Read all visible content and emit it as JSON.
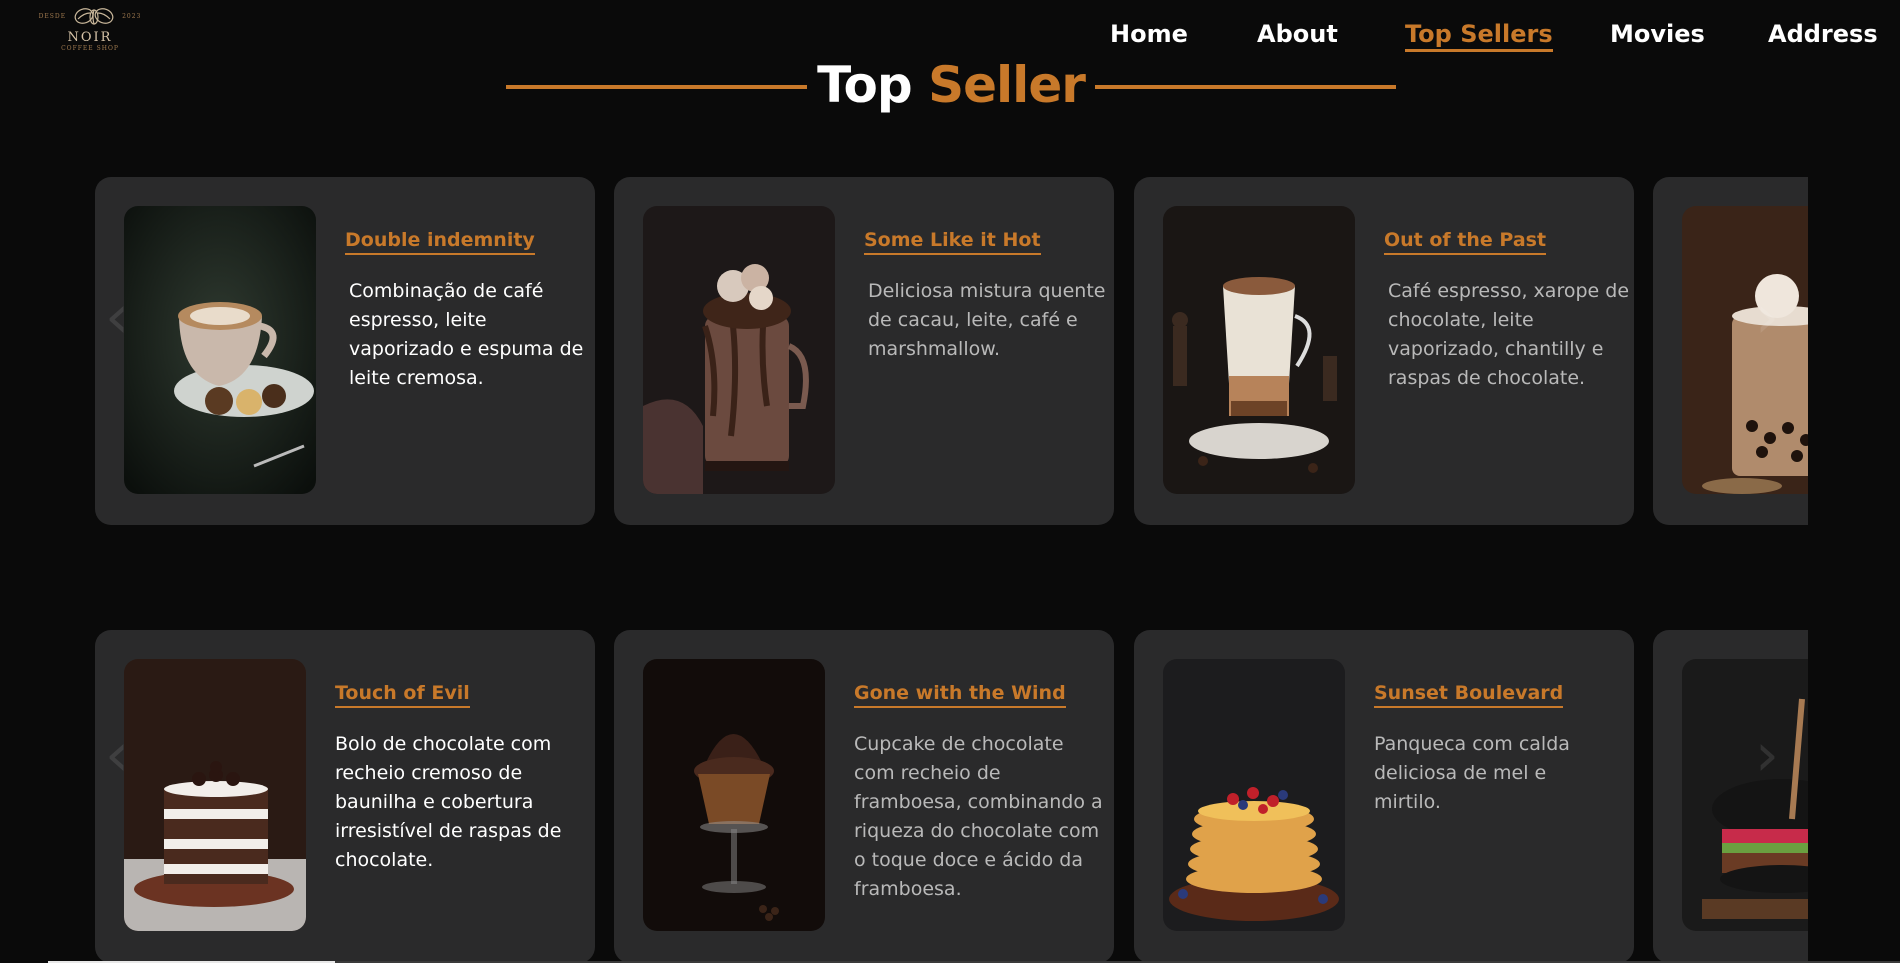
{
  "header": {
    "logo": {
      "since": "DESDE",
      "year": "2023",
      "name": "NOIR",
      "subtitle": "COFFEE SHOP"
    },
    "nav": [
      {
        "label": "Home",
        "active": false
      },
      {
        "label": "About",
        "active": false
      },
      {
        "label": "Top Sellers",
        "active": true
      },
      {
        "label": "Movies",
        "active": false
      },
      {
        "label": "Address",
        "active": false
      }
    ]
  },
  "section": {
    "title_main": "Top",
    "title_accent": "Seller"
  },
  "rows": [
    {
      "cards": [
        {
          "title": "Double indemnity",
          "desc": "Combinação de café espresso, leite vaporizado e espuma de leite cremosa.",
          "image": "latte-art-cup-with-cookies"
        },
        {
          "title": "Some Like it Hot",
          "desc": "Deliciosa mistura quente de cacau, leite, café e marshmallow.",
          "image": "chocolate-freakshake-jar"
        },
        {
          "title": "Out of the Past",
          "desc": "Café espresso, xarope de chocolate, leite vaporizado, chantilly e raspas de chocolate.",
          "image": "layered-mocha-glass"
        },
        {
          "title": "",
          "desc": "",
          "image": "bubble-tea-jar"
        }
      ]
    },
    {
      "cards": [
        {
          "title": "Touch of Evil",
          "desc": "Bolo de chocolate com recheio cremoso de baunilha e cobertura irresistível de raspas de chocolate.",
          "image": "layered-chocolate-cake"
        },
        {
          "title": "Gone with the Wind",
          "desc": "Cupcake de chocolate com recheio de framboesa, combinando a riqueza do chocolate com o toque doce e ácido da framboesa.",
          "image": "chocolate-cupcake-stand"
        },
        {
          "title": "Sunset Boulevard",
          "desc": "Panqueca com calda deliciosa de mel e mirtilo.",
          "image": "pancake-stack-berries"
        },
        {
          "title": "",
          "desc": "",
          "image": "black-bun-burger"
        }
      ]
    }
  ],
  "colors": {
    "background": "#0a0a0a",
    "card": "#2a2a2b",
    "accent": "#c8792a",
    "text": "#ffffff",
    "muted_text": "#b9b9b9"
  },
  "icons": {
    "prev": "chevron-left-icon",
    "next": "chevron-right-icon"
  }
}
